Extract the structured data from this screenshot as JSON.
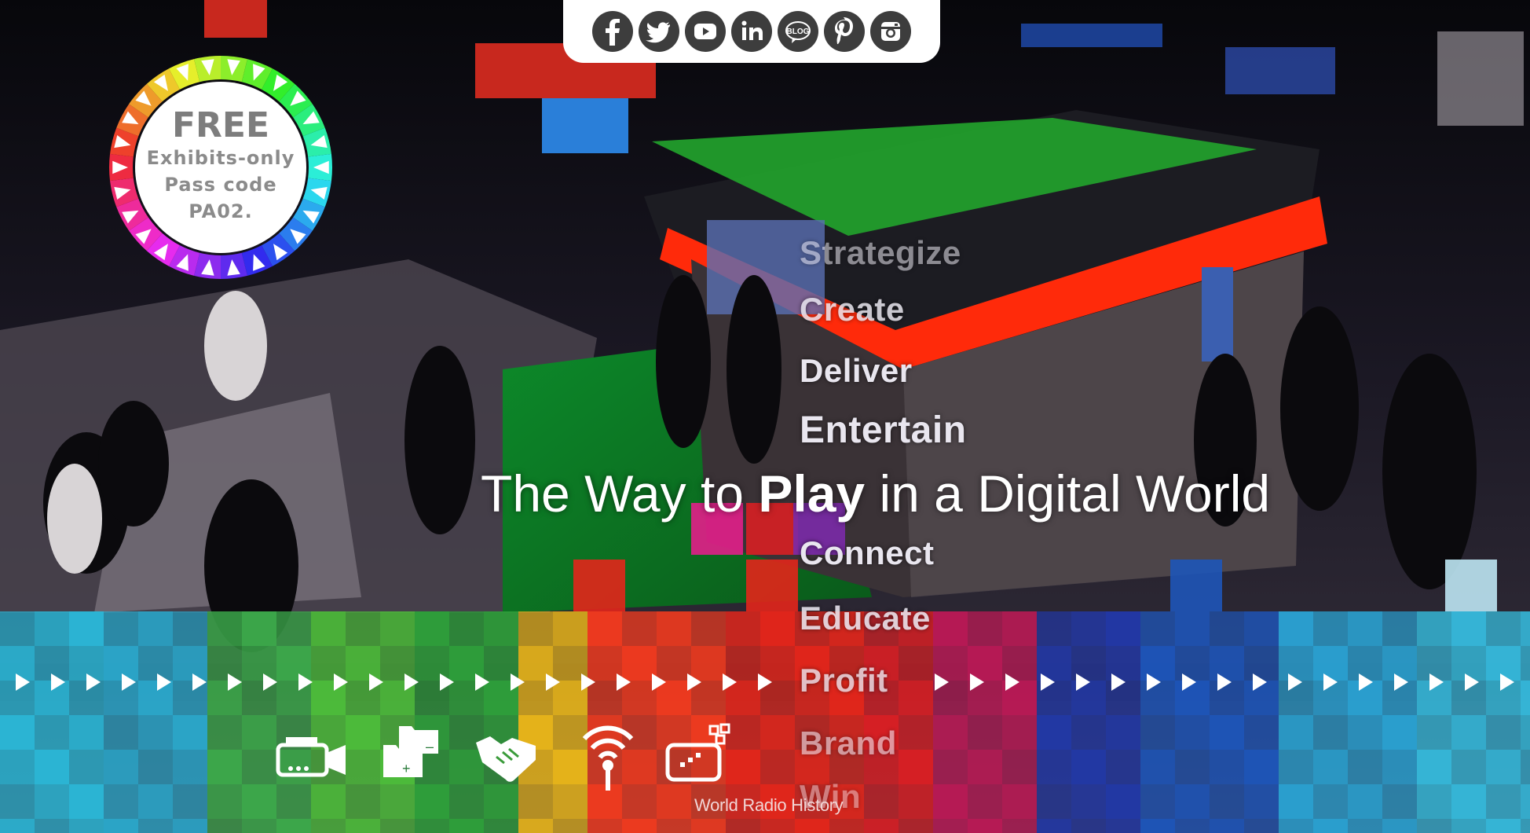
{
  "colors": {
    "social_icon_bg": "#3d3d3d",
    "badge_text": "#8b8b8b",
    "headline": "#ffffff",
    "verbs": "#e9e6ef"
  },
  "social": {
    "icons": [
      {
        "name": "facebook-icon",
        "glyph": "f"
      },
      {
        "name": "twitter-icon",
        "glyph": ""
      },
      {
        "name": "youtube-icon",
        "glyph": ""
      },
      {
        "name": "linkedin-icon",
        "glyph": "in"
      },
      {
        "name": "blog-icon",
        "glyph": "BLOG"
      },
      {
        "name": "pinterest-icon",
        "glyph": "P"
      },
      {
        "name": "instagram-icon",
        "glyph": ""
      }
    ]
  },
  "badge": {
    "free": "FREE",
    "line1": "Exhibits-only",
    "line2": "Pass code",
    "line3": "PA02."
  },
  "verbs": {
    "strategize": "Strategize",
    "create": "Create",
    "deliver": "Deliver",
    "entertain": "Entertain",
    "connect": "Connect",
    "educate": "Educate",
    "profit": "Profit",
    "brand": "Brand",
    "win": "Win"
  },
  "headline": {
    "part1": "The Way to ",
    "emphasis": "Play",
    "part2": " in a Digital World"
  },
  "feature_icons": [
    "camera-icon",
    "folders-icon",
    "handshake-icon",
    "wireless-antenna-icon",
    "digital-display-icon"
  ],
  "credit": "World Radio History"
}
